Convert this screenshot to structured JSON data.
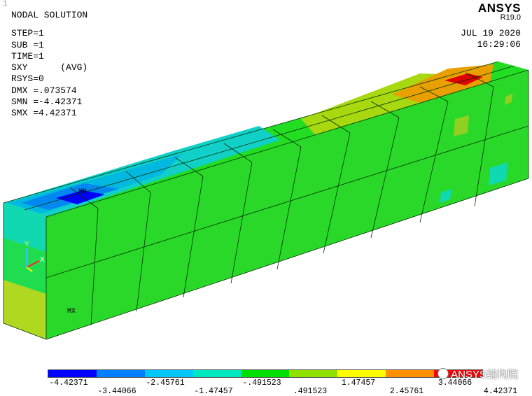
{
  "window_number": "1",
  "header": {
    "title": "NODAL SOLUTION",
    "step": "STEP=1",
    "sub": "SUB =1",
    "time": "TIME=1",
    "component": "SXY      (AVG)",
    "rsys": "RSYS=0",
    "dmx": "DMX =.073574",
    "smn": "SMN =-4.42371",
    "smx": "SMX =4.42371"
  },
  "brand": {
    "name": "ANSYS",
    "version": "R19.0"
  },
  "datetime": {
    "date": "JUL 19 2020",
    "time": "16:29:06"
  },
  "model_labels": {
    "min": "MN",
    "max": "MX",
    "axis_x": "X",
    "axis_y": "Y"
  },
  "legend": {
    "colors": [
      "#0000ff",
      "#0080ff",
      "#00c8ff",
      "#00e8c0",
      "#00e000",
      "#90e000",
      "#ffff00",
      "#ff9000",
      "#ff0000"
    ],
    "ticks_top": [
      "-4.42371",
      "-2.45761",
      "-.491523",
      "1.47457",
      "3.44066"
    ],
    "ticks_bottom": [
      "-3.44066",
      "-1.47457",
      ".491523",
      "2.45761",
      "4.42371"
    ]
  },
  "watermark": "ANSYS结构院"
}
